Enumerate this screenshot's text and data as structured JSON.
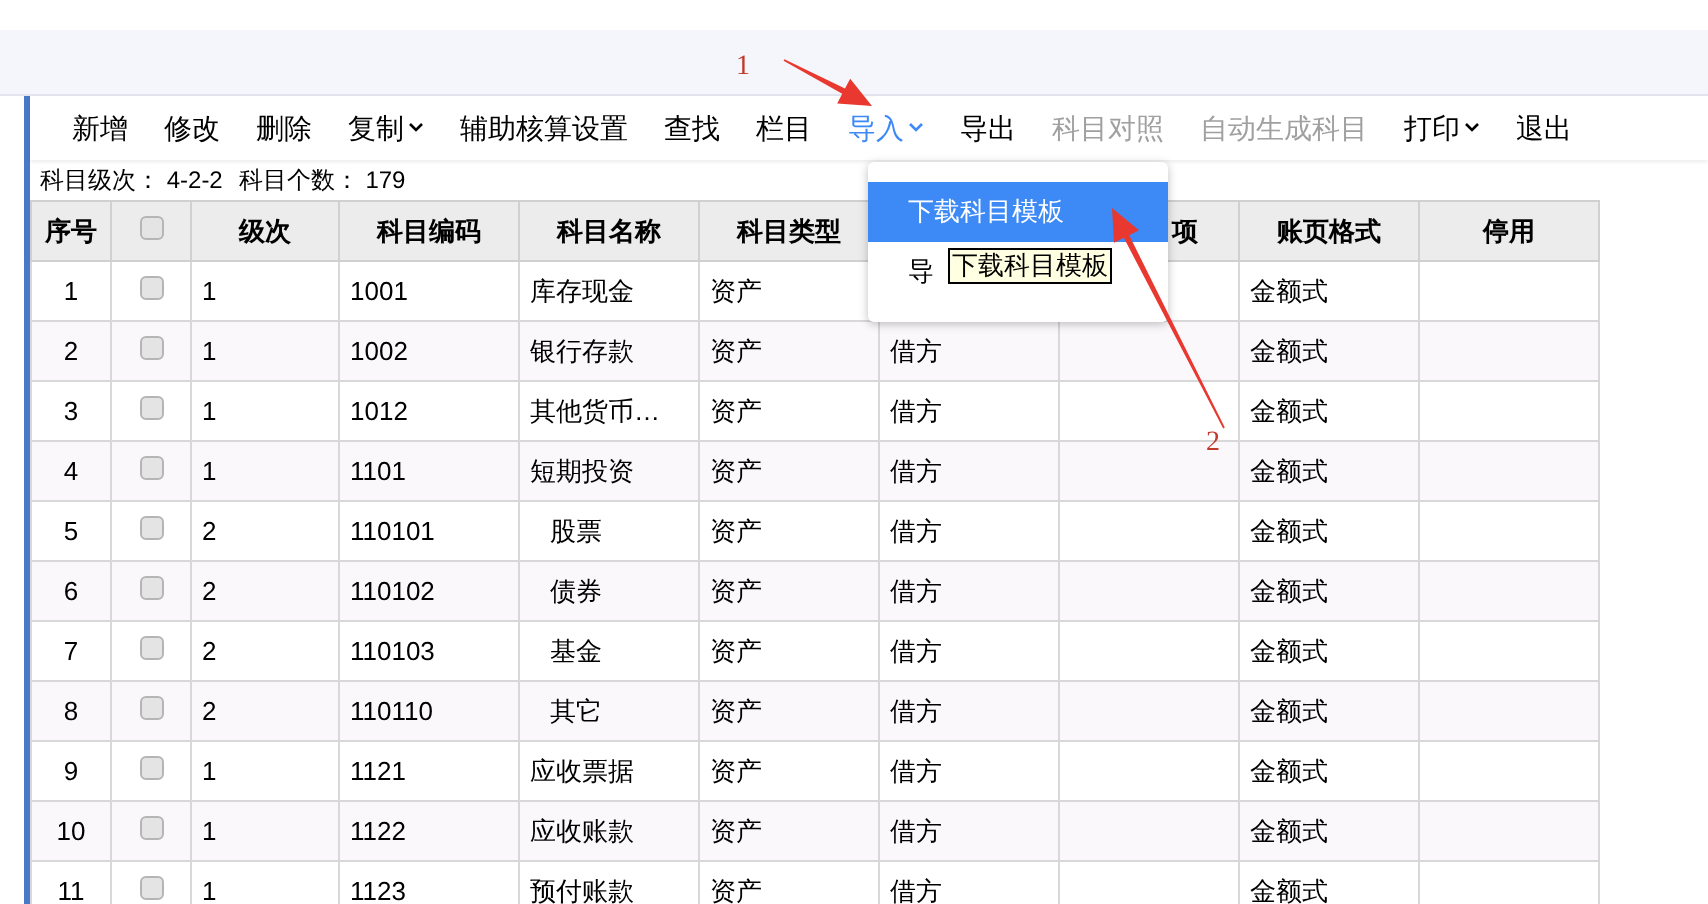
{
  "toolbar": [
    {
      "label": "新增",
      "kind": "plain",
      "active": false,
      "disabled": false
    },
    {
      "label": "修改",
      "kind": "plain",
      "active": false,
      "disabled": false
    },
    {
      "label": "删除",
      "kind": "plain",
      "active": false,
      "disabled": false
    },
    {
      "label": "复制",
      "kind": "menu",
      "active": false,
      "disabled": false
    },
    {
      "label": "辅助核算设置",
      "kind": "plain",
      "active": false,
      "disabled": false
    },
    {
      "label": "查找",
      "kind": "plain",
      "active": false,
      "disabled": false
    },
    {
      "label": "栏目",
      "kind": "plain",
      "active": false,
      "disabled": false
    },
    {
      "label": "导入",
      "kind": "menu",
      "active": true,
      "disabled": false
    },
    {
      "label": "导出",
      "kind": "plain",
      "active": false,
      "disabled": false
    },
    {
      "label": "科目对照",
      "kind": "plain",
      "active": false,
      "disabled": true
    },
    {
      "label": "自动生成科目",
      "kind": "plain",
      "active": false,
      "disabled": true
    },
    {
      "label": "打印",
      "kind": "menu",
      "active": false,
      "disabled": false
    },
    {
      "label": "退出",
      "kind": "plain",
      "active": false,
      "disabled": false
    }
  ],
  "info": [
    {
      "label": "科目级次：",
      "value": "4-2-2"
    },
    {
      "label": "科目个数：",
      "value": "179"
    }
  ],
  "table": {
    "columns": [
      "序号",
      "",
      "级次",
      "科目编码",
      "科目名称",
      "科目类型",
      "",
      "项",
      "账页格式",
      "停用"
    ],
    "header_checked": false,
    "rows": [
      {
        "cells": [
          "1",
          "",
          "1",
          "1001",
          "库存现金",
          "资产",
          "",
          "",
          "金额式",
          ""
        ],
        "checked": false,
        "indented": false
      },
      {
        "cells": [
          "2",
          "",
          "1",
          "1002",
          "银行存款",
          "资产",
          "借方",
          "",
          "金额式",
          ""
        ],
        "checked": false,
        "indented": false
      },
      {
        "cells": [
          "3",
          "",
          "1",
          "1012",
          "其他货币…",
          "资产",
          "借方",
          "",
          "金额式",
          ""
        ],
        "checked": false,
        "indented": false
      },
      {
        "cells": [
          "4",
          "",
          "1",
          "1101",
          "短期投资",
          "资产",
          "借方",
          "",
          "金额式",
          ""
        ],
        "checked": false,
        "indented": false
      },
      {
        "cells": [
          "5",
          "",
          "2",
          "110101",
          "股票",
          "资产",
          "借方",
          "",
          "金额式",
          ""
        ],
        "checked": false,
        "indented": true
      },
      {
        "cells": [
          "6",
          "",
          "2",
          "110102",
          "债券",
          "资产",
          "借方",
          "",
          "金额式",
          ""
        ],
        "checked": false,
        "indented": true
      },
      {
        "cells": [
          "7",
          "",
          "2",
          "110103",
          "基金",
          "资产",
          "借方",
          "",
          "金额式",
          ""
        ],
        "checked": false,
        "indented": true
      },
      {
        "cells": [
          "8",
          "",
          "2",
          "110110",
          "其它",
          "资产",
          "借方",
          "",
          "金额式",
          ""
        ],
        "checked": false,
        "indented": true
      },
      {
        "cells": [
          "9",
          "",
          "1",
          "1121",
          "应收票据",
          "资产",
          "借方",
          "",
          "金额式",
          ""
        ],
        "checked": false,
        "indented": false
      },
      {
        "cells": [
          "10",
          "",
          "1",
          "1122",
          "应收账款",
          "资产",
          "借方",
          "",
          "金额式",
          ""
        ],
        "checked": false,
        "indented": false
      },
      {
        "cells": [
          "11",
          "",
          "1",
          "1123",
          "预付账款",
          "资产",
          "借方",
          "",
          "金额式",
          ""
        ],
        "checked": false,
        "indented": false
      }
    ]
  },
  "dropdown": {
    "items": [
      {
        "label": "下载科目模板",
        "selected": true
      },
      {
        "label": "导",
        "selected": false
      }
    ],
    "tooltip": "下载科目模板"
  },
  "annotations": [
    {
      "label": "1"
    },
    {
      "label": "2"
    }
  ]
}
